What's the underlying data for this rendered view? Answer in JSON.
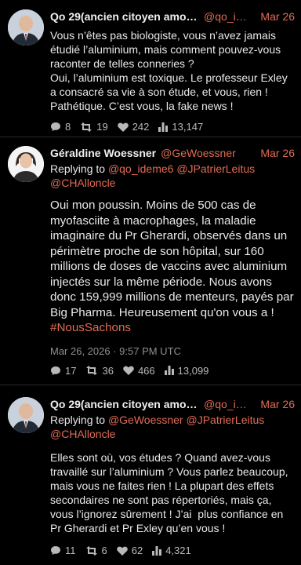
{
  "tweets": [
    {
      "name": "Qo 29(ancien citoyen amoure...",
      "handle": "@qo_ide...",
      "date": "Mar 26",
      "text": "Vous n’êtes pas biologiste, vous n’avez jamais étudié l’aluminium, mais comment pouvez-vous raconter de telles conneries ?\nOui, l’aluminium est toxique. Le professeur Exley a consacré sa vie à son étude, et vous, rien ! Pathétique. C’est vous, la fake news !",
      "replies": "8",
      "retweets": "19",
      "likes": "242",
      "views": "13,147"
    },
    {
      "name": "Géraldine Woessner",
      "handle": "@GeWoessner",
      "date": "Mar 26",
      "reply_prefix": "Replying to",
      "mentions": [
        "@qo_ideme6",
        "@JPatrierLeitus",
        "@CHAlloncle"
      ],
      "text": "Oui mon poussin. Moins de 500 cas de myofasciite à macrophages, la maladie imaginaire du Pr Gherardi, observés dans un périmètre proche de son hôpital, sur 160 millions de doses de vaccins avec aluminium injectés sur la même période. Nous avons donc 159,999 millions de menteurs, payés par Big Pharma. Heureusement qu'on vous a !",
      "hashtag": "#NousSachons",
      "timestamp": "Mar 26, 2026 · 9:57 PM UTC",
      "replies": "17",
      "retweets": "36",
      "likes": "466",
      "views": "13,099"
    },
    {
      "name": "Qo 29(ancien citoyen amoure...",
      "handle": "@qo_ide...",
      "date": "Mar 26",
      "reply_prefix": "Replying to",
      "mentions": [
        "@GeWoessner",
        "@JPatrierLeitus",
        "@CHAlloncle"
      ],
      "text": "Elles sont où, vos études ? Quand avez-vous travaillé sur l’aluminium ? Vous parlez beaucoup, mais vous ne faites rien ! La plupart des effets secondaires ne sont pas répertoriés, mais ça, vous l’ignorez sûrement ! J’ai  plus confiance en Pr Gherardi et Pr Exley qu’en vous !",
      "replies": "11",
      "retweets": "6",
      "likes": "62",
      "views": "4,321"
    }
  ],
  "icons": {
    "reply": "comment-icon",
    "retweet": "retweet-icon",
    "like": "heart-icon",
    "views": "bar-chart-icon"
  },
  "colors": {
    "background": "#000000",
    "accent": "#e26b55",
    "muted": "#8f8f8f"
  }
}
